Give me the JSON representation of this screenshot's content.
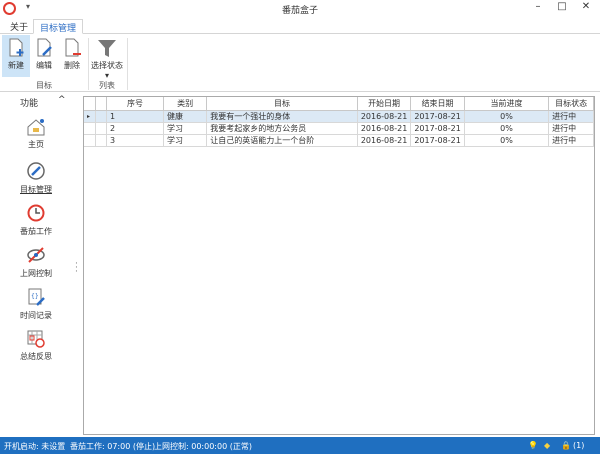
{
  "window": {
    "title": "番茄盒子"
  },
  "tabs": [
    {
      "label": "关于"
    },
    {
      "label": "目标管理"
    }
  ],
  "ribbon": {
    "buttons": [
      {
        "label": "新建",
        "icon": "new-doc-icon"
      },
      {
        "label": "编辑",
        "icon": "edit-doc-icon"
      },
      {
        "label": "删除",
        "icon": "delete-doc-icon"
      },
      {
        "label": "选择状态",
        "icon": "filter-icon"
      }
    ],
    "groups": [
      {
        "label": "目标"
      },
      {
        "label": "列表"
      }
    ]
  },
  "sidebar": {
    "header": "功能",
    "items": [
      {
        "label": "主页"
      },
      {
        "label": "目标管理"
      },
      {
        "label": "番茄工作"
      },
      {
        "label": "上网控制"
      },
      {
        "label": "时间记录"
      },
      {
        "label": "总结反思"
      }
    ]
  },
  "grid": {
    "columns": [
      "序号",
      "类别",
      "目标",
      "开始日期",
      "结束日期",
      "当前进度",
      "目标状态"
    ],
    "rows": [
      [
        "1",
        "健康",
        "我要有一个强壮的身体",
        "2016-08-21",
        "2017-08-21",
        "0%",
        "进行中"
      ],
      [
        "2",
        "学习",
        "我要考起家乡的地方公务员",
        "2016-08-21",
        "2017-08-21",
        "0%",
        "进行中"
      ],
      [
        "3",
        "学习",
        "让自己的英语能力上一个台阶",
        "2016-08-21",
        "2017-08-21",
        "0%",
        "进行中"
      ]
    ]
  },
  "status": {
    "startup": "开机启动: 未设置",
    "tomato": "番茄工作: 07:00 (停止)",
    "net": "上网控制: 00:00:00 (正常)",
    "lock_count": "(1)"
  },
  "colors": {
    "accent": "#2b6cc4",
    "status_bar": "#1f6fc0",
    "icon_red": "#e03c31"
  }
}
